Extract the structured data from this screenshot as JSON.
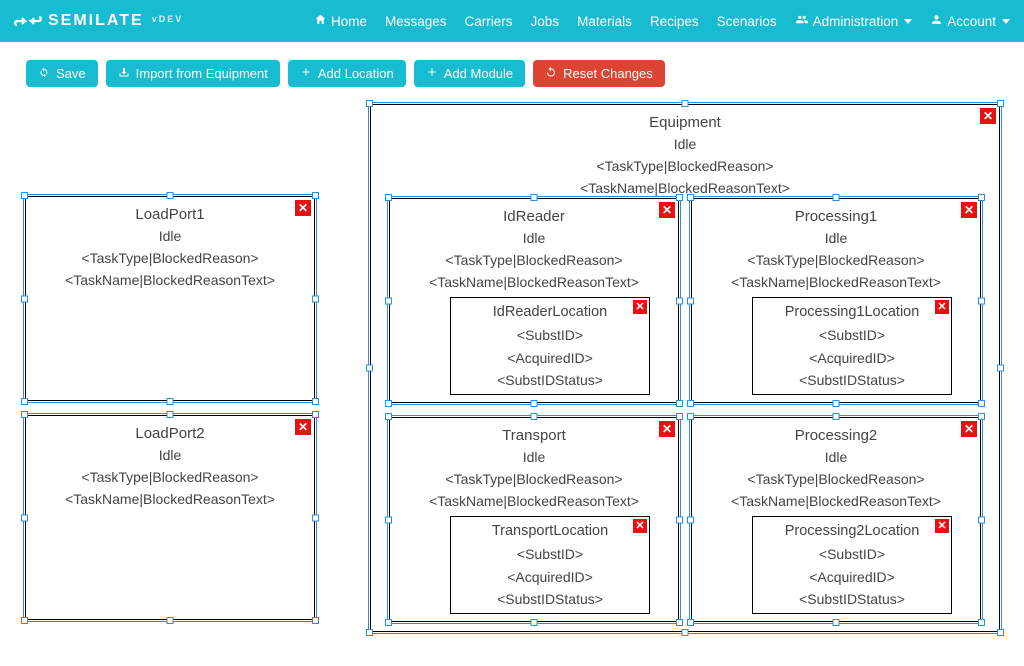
{
  "brand": {
    "name": "SEMILATE",
    "version": "vDEV"
  },
  "nav": {
    "home": "Home",
    "messages": "Messages",
    "carriers": "Carriers",
    "jobs": "Jobs",
    "materials": "Materials",
    "recipes": "Recipes",
    "scenarios": "Scenarios",
    "administration": "Administration",
    "account": "Account"
  },
  "toolbar": {
    "save": "Save",
    "import": "Import from Equipment",
    "add_location": "Add Location",
    "add_module": "Add Module",
    "reset": "Reset Changes"
  },
  "blocks": {
    "equipment": {
      "title": "Equipment",
      "state": "Idle",
      "line1": "<TaskType|BlockedReason>",
      "line2": "<TaskName|BlockedReasonText>"
    },
    "loadport1": {
      "title": "LoadPort1",
      "state": "Idle",
      "line1": "<TaskType|BlockedReason>",
      "line2": "<TaskName|BlockedReasonText>"
    },
    "loadport2": {
      "title": "LoadPort2",
      "state": "Idle",
      "line1": "<TaskType|BlockedReason>",
      "line2": "<TaskName|BlockedReasonText>"
    },
    "idreader": {
      "title": "IdReader",
      "state": "Idle",
      "line1": "<TaskType|BlockedReason>",
      "line2": "<TaskName|BlockedReasonText>",
      "loc": {
        "title": "IdReaderLocation",
        "l1": "<SubstID>",
        "l2": "<AcquiredID>",
        "l3": "<SubstIDStatus>"
      }
    },
    "processing1": {
      "title": "Processing1",
      "state": "Idle",
      "line1": "<TaskType|BlockedReason>",
      "line2": "<TaskName|BlockedReasonText>",
      "loc": {
        "title": "Processing1Location",
        "l1": "<SubstID>",
        "l2": "<AcquiredID>",
        "l3": "<SubstIDStatus>"
      }
    },
    "transport": {
      "title": "Transport",
      "state": "Idle",
      "line1": "<TaskType|BlockedReason>",
      "line2": "<TaskName|BlockedReasonText>",
      "loc": {
        "title": "TransportLocation",
        "l1": "<SubstID>",
        "l2": "<AcquiredID>",
        "l3": "<SubstIDStatus>"
      }
    },
    "processing2": {
      "title": "Processing2",
      "state": "Idle",
      "line1": "<TaskType|BlockedReason>",
      "line2": "<TaskName|BlockedReasonText>",
      "loc": {
        "title": "Processing2Location",
        "l1": "<SubstID>",
        "l2": "<AcquiredID>",
        "l3": "<SubstIDStatus>"
      }
    }
  }
}
